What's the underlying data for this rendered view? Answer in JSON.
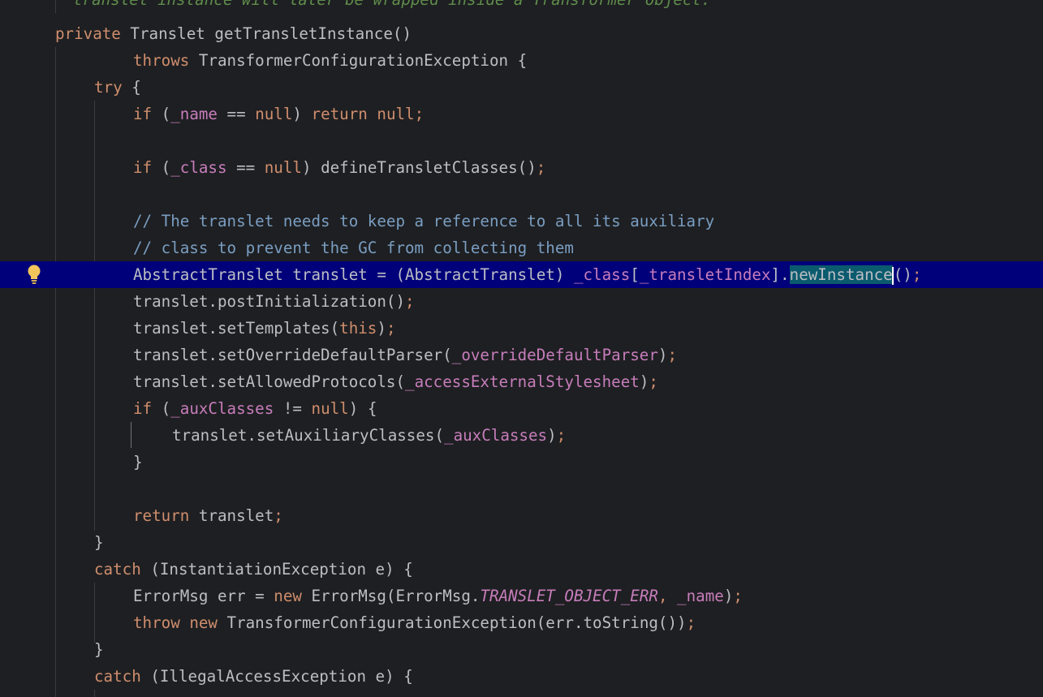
{
  "editor": {
    "language": "java",
    "colors": {
      "background": "#1e1f22",
      "keyword": "#cf8e6d",
      "field": "#c77dbb",
      "comment": "#7a9ec2",
      "current_line": "#00007a",
      "selection": "#0b5b6e"
    },
    "gutter_icon": "lightbulb-icon",
    "lines": [
      {
        "tokens": [
          {
            "t": "translet instance will later be wrapped inside a Transformer object.",
            "c": "doc"
          }
        ]
      },
      {
        "tokens": [
          {
            "t": "private ",
            "c": "kw"
          },
          {
            "t": "Translet ",
            "c": "fn"
          },
          {
            "t": "getTransletInstance",
            "c": "fn"
          },
          {
            "t": "()",
            "c": "fn"
          }
        ]
      },
      {
        "tokens": [
          {
            "t": "throws ",
            "c": "kw"
          },
          {
            "t": "TransformerConfigurationException {",
            "c": "fn"
          }
        ]
      },
      {
        "tokens": [
          {
            "t": "try ",
            "c": "kw"
          },
          {
            "t": "{",
            "c": "fn"
          }
        ]
      },
      {
        "tokens": [
          {
            "t": "if ",
            "c": "kw"
          },
          {
            "t": "(",
            "c": "fn"
          },
          {
            "t": "_name",
            "c": "fld"
          },
          {
            "t": " == ",
            "c": "fn"
          },
          {
            "t": "null",
            "c": "kw"
          },
          {
            "t": ") ",
            "c": "fn"
          },
          {
            "t": "return ",
            "c": "kw"
          },
          {
            "t": "null",
            "c": "kw"
          },
          {
            "t": ";",
            "c": "pun"
          }
        ]
      },
      {
        "tokens": []
      },
      {
        "tokens": [
          {
            "t": "if ",
            "c": "kw"
          },
          {
            "t": "(",
            "c": "fn"
          },
          {
            "t": "_class",
            "c": "fld"
          },
          {
            "t": " == ",
            "c": "fn"
          },
          {
            "t": "null",
            "c": "kw"
          },
          {
            "t": ") defineTransletClasses()",
            "c": "fn"
          },
          {
            "t": ";",
            "c": "pun"
          }
        ]
      },
      {
        "tokens": []
      },
      {
        "tokens": [
          {
            "t": "// The translet needs to keep a reference to all its auxiliary",
            "c": "cm"
          }
        ]
      },
      {
        "tokens": [
          {
            "t": "// class to prevent the GC from collecting them",
            "c": "cm"
          }
        ]
      },
      {
        "tokens": [
          {
            "t": "AbstractTranslet translet = (AbstractTranslet) ",
            "c": "fn"
          },
          {
            "t": "_class",
            "c": "fld"
          },
          {
            "t": "[",
            "c": "fn"
          },
          {
            "t": "_transletIndex",
            "c": "fld"
          },
          {
            "t": "].",
            "c": "fn"
          },
          {
            "t": "newInstance",
            "c": "sel"
          },
          {
            "t": "()",
            "c": "fn"
          },
          {
            "t": ";",
            "c": "pun"
          }
        ]
      },
      {
        "tokens": [
          {
            "t": "translet.postInitialization()",
            "c": "fn"
          },
          {
            "t": ";",
            "c": "pun"
          }
        ]
      },
      {
        "tokens": [
          {
            "t": "translet.setTemplates(",
            "c": "fn"
          },
          {
            "t": "this",
            "c": "kw"
          },
          {
            "t": ")",
            "c": "fn"
          },
          {
            "t": ";",
            "c": "pun"
          }
        ]
      },
      {
        "tokens": [
          {
            "t": "translet.setOverrideDefaultParser(",
            "c": "fn"
          },
          {
            "t": "_overrideDefaultParser",
            "c": "fld"
          },
          {
            "t": ")",
            "c": "fn"
          },
          {
            "t": ";",
            "c": "pun"
          }
        ]
      },
      {
        "tokens": [
          {
            "t": "translet.setAllowedProtocols(",
            "c": "fn"
          },
          {
            "t": "_accessExternalStylesheet",
            "c": "fld"
          },
          {
            "t": ")",
            "c": "fn"
          },
          {
            "t": ";",
            "c": "pun"
          }
        ]
      },
      {
        "tokens": [
          {
            "t": "if ",
            "c": "kw"
          },
          {
            "t": "(",
            "c": "fn"
          },
          {
            "t": "_auxClasses",
            "c": "fld"
          },
          {
            "t": " != ",
            "c": "fn"
          },
          {
            "t": "null",
            "c": "kw"
          },
          {
            "t": ") {",
            "c": "fn"
          }
        ]
      },
      {
        "tokens": [
          {
            "t": "translet.setAuxiliaryClasses(",
            "c": "fn"
          },
          {
            "t": "_auxClasses",
            "c": "fld"
          },
          {
            "t": ")",
            "c": "fn"
          },
          {
            "t": ";",
            "c": "pun"
          }
        ]
      },
      {
        "tokens": [
          {
            "t": "}",
            "c": "fn"
          }
        ]
      },
      {
        "tokens": []
      },
      {
        "tokens": [
          {
            "t": "return ",
            "c": "kw"
          },
          {
            "t": "translet",
            "c": "fn"
          },
          {
            "t": ";",
            "c": "pun"
          }
        ]
      },
      {
        "tokens": [
          {
            "t": "}",
            "c": "fn"
          }
        ]
      },
      {
        "tokens": [
          {
            "t": "catch ",
            "c": "kw"
          },
          {
            "t": "(InstantiationException e) {",
            "c": "fn"
          }
        ]
      },
      {
        "tokens": [
          {
            "t": "ErrorMsg err = ",
            "c": "fn"
          },
          {
            "t": "new ",
            "c": "kw"
          },
          {
            "t": "ErrorMsg(ErrorMsg.",
            "c": "fn"
          },
          {
            "t": "TRANSLET_OBJECT_ERR",
            "c": "cst"
          },
          {
            "t": ", ",
            "c": "pun"
          },
          {
            "t": "_name",
            "c": "fld"
          },
          {
            "t": ")",
            "c": "fn"
          },
          {
            "t": ";",
            "c": "pun"
          }
        ]
      },
      {
        "tokens": [
          {
            "t": "throw ",
            "c": "kw"
          },
          {
            "t": "new ",
            "c": "kw"
          },
          {
            "t": "TransformerConfigurationException(err.toString())",
            "c": "fn"
          },
          {
            "t": ";",
            "c": "pun"
          }
        ]
      },
      {
        "tokens": [
          {
            "t": "}",
            "c": "fn"
          }
        ]
      },
      {
        "tokens": [
          {
            "t": "catch ",
            "c": "kw"
          },
          {
            "t": "(IllegalAccessException e) {",
            "c": "fn"
          }
        ]
      }
    ]
  }
}
